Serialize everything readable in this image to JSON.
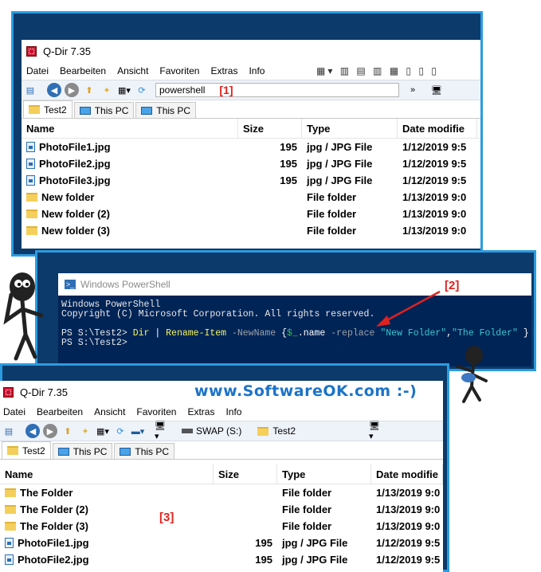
{
  "window_top": {
    "title": "Q-Dir 7.35",
    "menu": [
      "Datei",
      "Bearbeiten",
      "Ansicht",
      "Favoriten",
      "Extras",
      "Info"
    ],
    "address": "powershell",
    "address_marker": "[1]",
    "tabs": [
      "Test2",
      "This PC",
      "This PC"
    ],
    "columns": [
      "Name",
      "Size",
      "Type",
      "Date modifie"
    ],
    "rows": [
      {
        "icon": "jpg-file-icon",
        "name": "PhotoFile1.jpg",
        "size": "195",
        "type": "jpg / JPG File",
        "date": "1/12/2019 9:5"
      },
      {
        "icon": "jpg-file-icon",
        "name": "PhotoFile2.jpg",
        "size": "195",
        "type": "jpg / JPG File",
        "date": "1/12/2019 9:5"
      },
      {
        "icon": "jpg-file-icon",
        "name": "PhotoFile3.jpg",
        "size": "195",
        "type": "jpg / JPG File",
        "date": "1/12/2019 9:5"
      },
      {
        "icon": "folder-icon",
        "name": "New folder",
        "size": "",
        "type": "File folder",
        "date": "1/13/2019 9:0"
      },
      {
        "icon": "folder-icon",
        "name": "New folder (2)",
        "size": "",
        "type": "File folder",
        "date": "1/13/2019 9:0"
      },
      {
        "icon": "folder-icon",
        "name": "New folder (3)",
        "size": "",
        "type": "File folder",
        "date": "1/13/2019 9:0"
      }
    ]
  },
  "powershell": {
    "title": "Windows PowerShell",
    "marker": "[2]",
    "line1": "Windows PowerShell",
    "line2": "Copyright (C) Microsoft Corporation. All rights reserved.",
    "prompt1": "PS S:\\Test2> ",
    "cmd_dir": "Dir",
    "cmd_pipe": " | ",
    "cmd_rename": "Rename-Item",
    "cmd_param": " -NewName ",
    "cmd_brace_open": "{",
    "cmd_var": "$_",
    "cmd_name": ".name ",
    "cmd_replace": "-replace ",
    "cmd_arg1": "\"New Folder\"",
    "cmd_comma": ",",
    "cmd_arg2": "\"The Folder\"",
    "cmd_brace_close": " }",
    "prompt2": "PS S:\\Test2>"
  },
  "brand": "www.SoftwareOK.com :-)",
  "window_bottom": {
    "title": "Q-Dir 7.35",
    "menu": [
      "Datei",
      "Bearbeiten",
      "Ansicht",
      "Favoriten",
      "Extras",
      "Info"
    ],
    "drive": "SWAP (S:)",
    "folder": "Test2",
    "tabs": [
      "Test2",
      "This PC",
      "This PC"
    ],
    "columns": [
      "Name",
      "Size",
      "Type",
      "Date modifie"
    ],
    "marker": "[3]",
    "rows": [
      {
        "icon": "folder-icon",
        "name": "The Folder",
        "size": "",
        "type": "File folder",
        "date": "1/13/2019 9:0"
      },
      {
        "icon": "folder-icon",
        "name": "The Folder (2)",
        "size": "",
        "type": "File folder",
        "date": "1/13/2019 9:0"
      },
      {
        "icon": "folder-icon",
        "name": "The Folder (3)",
        "size": "",
        "type": "File folder",
        "date": "1/13/2019 9:0"
      },
      {
        "icon": "jpg-file-icon",
        "name": "PhotoFile1.jpg",
        "size": "195",
        "type": "jpg / JPG File",
        "date": "1/12/2019 9:5"
      },
      {
        "icon": "jpg-file-icon",
        "name": "PhotoFile2.jpg",
        "size": "195",
        "type": "jpg / JPG File",
        "date": "1/12/2019 9:5"
      }
    ]
  }
}
